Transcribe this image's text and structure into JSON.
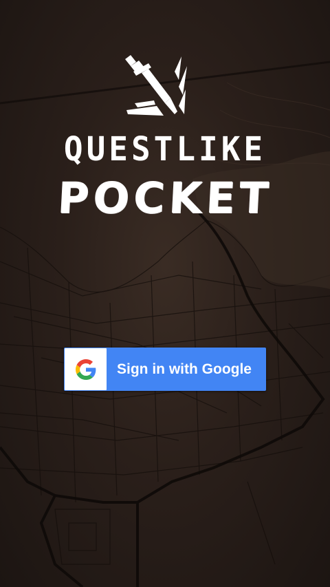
{
  "app": {
    "title_line1": "QUESTLIKE",
    "title_line2": "POCKET",
    "logo_icon": "sword-icon"
  },
  "signin": {
    "label": "Sign in with Google",
    "icon": "google-icon"
  },
  "colors": {
    "background": "#2a1f1a",
    "button": "#4285f4",
    "title": "#ffffff"
  }
}
